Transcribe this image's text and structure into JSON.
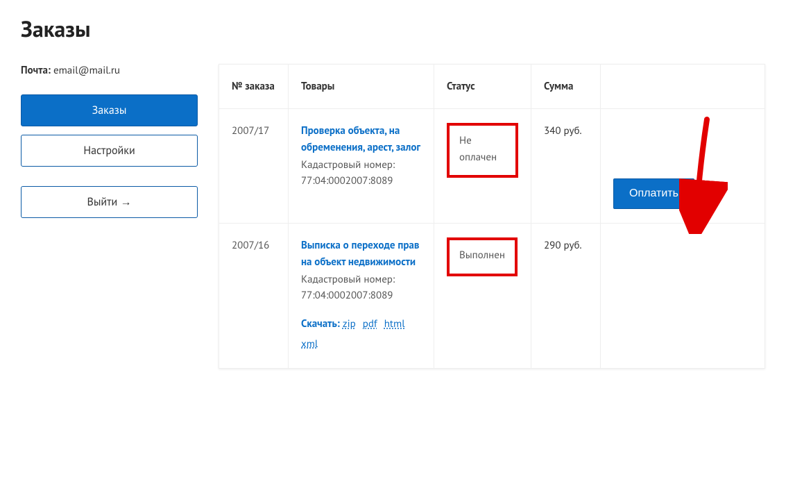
{
  "page_title": "Заказы",
  "sidebar": {
    "email_label": "Почта:",
    "email_value": "email@mail.ru",
    "nav": {
      "orders": "Заказы",
      "settings": "Настройки",
      "logout": "Выйти →"
    }
  },
  "table": {
    "headers": {
      "order_no": "№ заказа",
      "products": "Товары",
      "status": "Статус",
      "sum": "Сумма",
      "action": ""
    },
    "rows": [
      {
        "order_no": "2007/17",
        "product_title": "Проверка объекта, на обременения, арест, залог",
        "product_sub": "Кадастровый номер: 77:04:0002007:8089",
        "status": "Не оплачен",
        "sum": "340 руб.",
        "action_label": "Оплатить",
        "has_download": false,
        "highlight_action": true
      },
      {
        "order_no": "2007/16",
        "product_title": "Выписка о переходе прав на объект недвижимости",
        "product_sub": "Кадастровый номер: 77:04:0002007:8089",
        "status": "Выполнен",
        "sum": "290 руб.",
        "action_label": "",
        "has_download": true,
        "download_label": "Скачать:",
        "download_links": [
          "zip",
          "pdf",
          "html",
          "xml"
        ]
      }
    ]
  }
}
